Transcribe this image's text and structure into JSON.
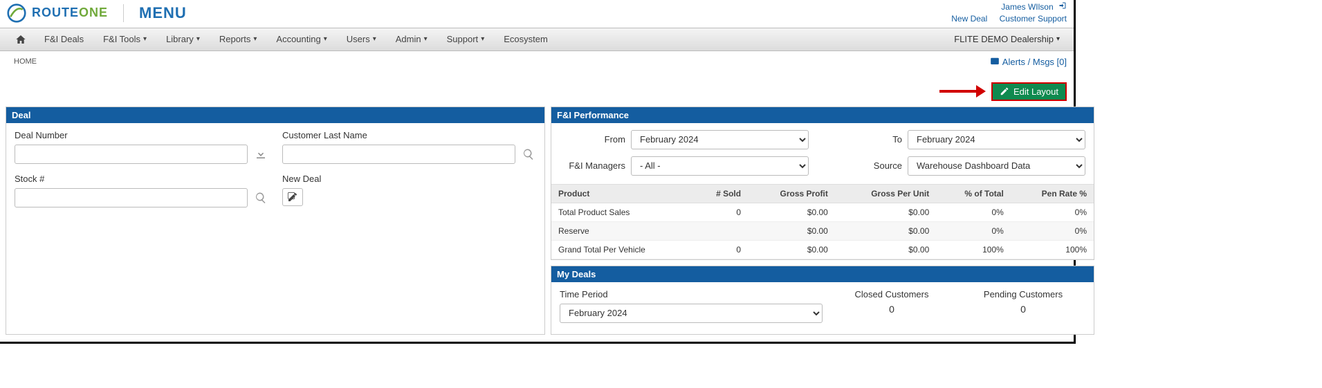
{
  "header": {
    "brand_prefix": "ROUTE",
    "brand_suffix": "ONE",
    "menu_label": "MENU",
    "user_name": "James WIlson",
    "links": {
      "new_deal": "New Deal",
      "support": "Customer Support"
    }
  },
  "nav": {
    "items": [
      {
        "label": "F&I Deals",
        "caret": false
      },
      {
        "label": "F&I Tools",
        "caret": true
      },
      {
        "label": "Library",
        "caret": true
      },
      {
        "label": "Reports",
        "caret": true
      },
      {
        "label": "Accounting",
        "caret": true
      },
      {
        "label": "Users",
        "caret": true
      },
      {
        "label": "Admin",
        "caret": true
      },
      {
        "label": "Support",
        "caret": true
      },
      {
        "label": "Ecosystem",
        "caret": false
      }
    ],
    "dealership": "FLITE DEMO Dealership"
  },
  "subbar": {
    "breadcrumb": "HOME",
    "alerts_label": "Alerts / Msgs [0]"
  },
  "actions": {
    "edit_layout": "Edit Layout"
  },
  "deal_panel": {
    "title": "Deal",
    "deal_number_label": "Deal Number",
    "customer_label": "Customer Last Name",
    "stock_label": "Stock #",
    "new_deal_label": "New Deal"
  },
  "perf_panel": {
    "title": "F&I Performance",
    "from_label": "From",
    "to_label": "To",
    "managers_label": "F&I Managers",
    "source_label": "Source",
    "from_value": "February 2024",
    "to_value": "February 2024",
    "managers_value": "- All -",
    "source_value": "Warehouse Dashboard Data",
    "columns": [
      "Product",
      "# Sold",
      "Gross Profit",
      "Gross Per Unit",
      "% of Total",
      "Pen Rate %"
    ],
    "rows": [
      {
        "c0": "Total Product Sales",
        "c1": "0",
        "c2": "$0.00",
        "c3": "$0.00",
        "c4": "0%",
        "c5": "0%"
      },
      {
        "c0": "Reserve",
        "c1": "",
        "c2": "$0.00",
        "c3": "$0.00",
        "c4": "0%",
        "c5": "0%"
      },
      {
        "c0": "Grand Total Per Vehicle",
        "c1": "0",
        "c2": "$0.00",
        "c3": "$0.00",
        "c4": "100%",
        "c5": "100%"
      }
    ]
  },
  "mydeals_panel": {
    "title": "My Deals",
    "period_label": "Time Period",
    "period_value": "February 2024",
    "closed_label": "Closed Customers",
    "pending_label": "Pending Customers",
    "closed_value": "0",
    "pending_value": "0"
  }
}
